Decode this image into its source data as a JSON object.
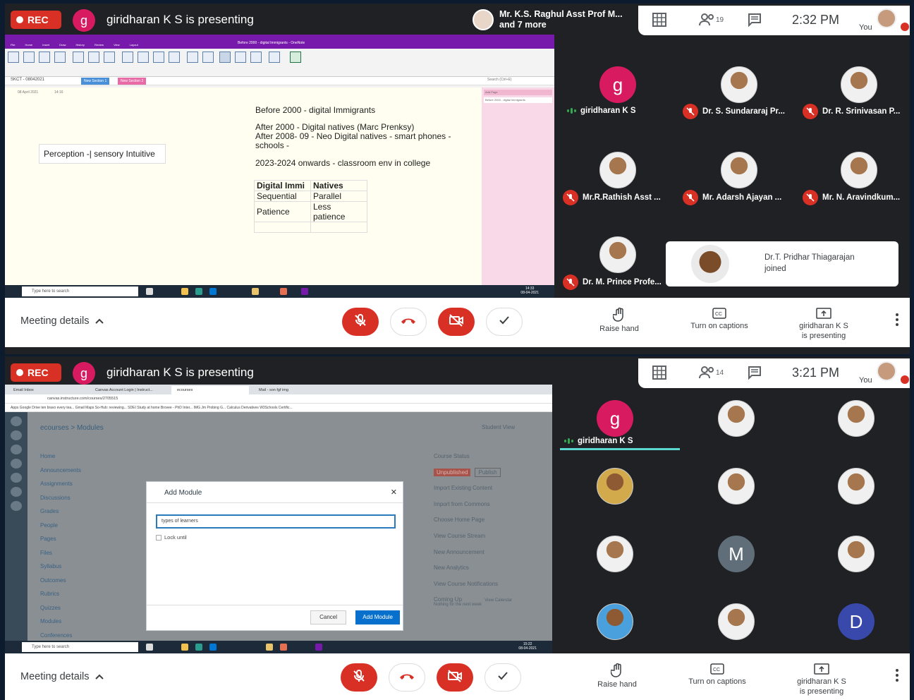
{
  "panels": [
    {
      "top_bar": {
        "rec_label": "REC",
        "presenter_initial": "g",
        "presenting_text": "giridharan K S is presenting",
        "other_presenters": "Mr. K.S. Raghul Asst Prof M...",
        "other_presenters_more": "and 7 more",
        "people_count": "19",
        "time": "2:32 PM",
        "you_label": "You"
      },
      "shared_screen": {
        "app": "OneNote",
        "window_title": "Before 2000 - digital Immigrants - OneNote",
        "ribbon_tabs": [
          "File",
          "Home",
          "Insert",
          "Draw",
          "History",
          "Review",
          "View",
          "Layout"
        ],
        "table_tools": "Table Tools",
        "ribbon_buttons": [
          "Select Table",
          "Select Columns",
          "Select Rows",
          "Select Cell",
          "Delete Table",
          "Delete Columns",
          "Delete Rows",
          "Insert Above",
          "Insert Below",
          "Insert Left",
          "Insert Right",
          "Hide Borders",
          "Shading",
          "Align Left",
          "Center",
          "Align Right",
          "Sort",
          "Convert to Excel Spreadsheet"
        ],
        "notebook": "SKCT - 08042021",
        "sections": [
          "New Section 1",
          "New Section 2"
        ],
        "search_placeholder": "Search (Ctrl+E)",
        "add_page": "Add Page",
        "page_list": [
          "Before 2000 - digital Immigrants"
        ],
        "page_date": "08 April 2021",
        "page_time": "14:16",
        "lines": [
          "Before 2000 - digital Immigrants",
          "After 2000 - Digital natives (Marc Prenksy)",
          "After 2008- 09 - Neo Digital natives - smart phones -",
          "schools -",
          "2023-2024 onwards - classroom env in college"
        ],
        "perception": "Perception -| sensory Intuitive",
        "table": [
          [
            "Digital Immi",
            "Natives"
          ],
          [
            "Sequential",
            "Parallel"
          ],
          [
            "Patience",
            "Less patience"
          ],
          [
            "",
            ""
          ]
        ],
        "taskbar": {
          "search": "Type here to search",
          "clock": "14:33",
          "date": "08-04-2021",
          "lang": "ENG"
        }
      },
      "participants": [
        {
          "name": "giridharan K S",
          "avatar": "g",
          "speaking": true
        },
        {
          "name": "Dr. S. Sundararaj Pr...",
          "muted": true
        },
        {
          "name": "Dr. R. Srinivasan P...",
          "muted": true
        },
        {
          "name": "Mr.R.Rathish Asst ...",
          "muted": true
        },
        {
          "name": "Mr. Adarsh Ajayan ...",
          "muted": true
        },
        {
          "name": "Mr. N. Aravindkum...",
          "muted": true
        },
        {
          "name": "Dr. M. Prince Profe...",
          "muted": true
        }
      ],
      "toast": {
        "line1": "Dr.T. Pridhar Thiagarajan",
        "line2": "joined"
      },
      "bottom_bar": {
        "meeting_details": "Meeting details",
        "raise_hand": "Raise hand",
        "captions": "Turn on captions",
        "presenting1": "giridharan K S",
        "presenting2": "is presenting"
      }
    },
    {
      "top_bar": {
        "rec_label": "REC",
        "presenter_initial": "g",
        "presenting_text": "giridharan K S is presenting",
        "people_count": "14",
        "time": "3:21 PM",
        "you_label": "You"
      },
      "shared_screen": {
        "app": "Canvas",
        "tabs": [
          "Email Inbox",
          "Canvas Account Login | Instruct...",
          "ecourses",
          "Mail - son fgf img"
        ],
        "url": "canvas.instructure.com/courses/2705515",
        "bookmarks": "Apps   Google Drive   ten bravo every tea...   Gmail   Maps   So-Hub: reviewing...   SDEI Study at home   Brovee - PhD Inter...   IMG Jm Probing G...   Calculus Derivatives   W3Schools Certific...",
        "breadcrumb": "ecourses > Modules",
        "student_view": "Student View",
        "course_menu": [
          "Home",
          "Announcements",
          "Assignments",
          "Discussions",
          "Grades",
          "People",
          "Pages",
          "Files",
          "Syllabus",
          "Outcomes",
          "Rubrics",
          "Quizzes",
          "Modules",
          "Conferences"
        ],
        "course_status": "Course Status",
        "unpublished": "Unpublished",
        "publish": "Publish",
        "side_actions": [
          "Import Existing Content",
          "Import from Commons",
          "Choose Home Page",
          "View Course Stream",
          "New Announcement",
          "New Analytics",
          "View Course Notifications"
        ],
        "coming_up": "Coming Up",
        "view_calendar": "View Calendar",
        "nothing": "Nothing for the next week",
        "modal": {
          "title": "Add Module",
          "input_value": "types of learners",
          "lock_label": "Lock until",
          "cancel": "Cancel",
          "add": "Add Module"
        },
        "taskbar": {
          "search": "Type here to search",
          "clock": "15:22",
          "date": "08-04-2021",
          "lang": "ENG"
        }
      },
      "participants": [
        {
          "name": "giridharan K S",
          "avatar": "g",
          "speaking": true
        },
        {
          "avatar": "photo"
        },
        {
          "avatar": "photo"
        },
        {
          "avatar": "photo"
        },
        {
          "avatar": "photo"
        },
        {
          "avatar": "photo"
        },
        {
          "avatar": "photo"
        },
        {
          "avatar": "M"
        },
        {
          "avatar": "photo"
        },
        {
          "avatar": "photo"
        },
        {
          "avatar": "photo"
        },
        {
          "avatar": "D"
        }
      ],
      "bottom_bar": {
        "meeting_details": "Meeting details",
        "raise_hand": "Raise hand",
        "captions": "Turn on captions",
        "presenting1": "giridharan K S",
        "presenting2": "is presenting"
      }
    }
  ],
  "colors": {
    "rec_red": "#d93025",
    "presenter_pink": "#d81b60",
    "meet_dark": "#202124",
    "onenote_purple": "#7719aa",
    "canvas_blue": "#0770cc"
  }
}
